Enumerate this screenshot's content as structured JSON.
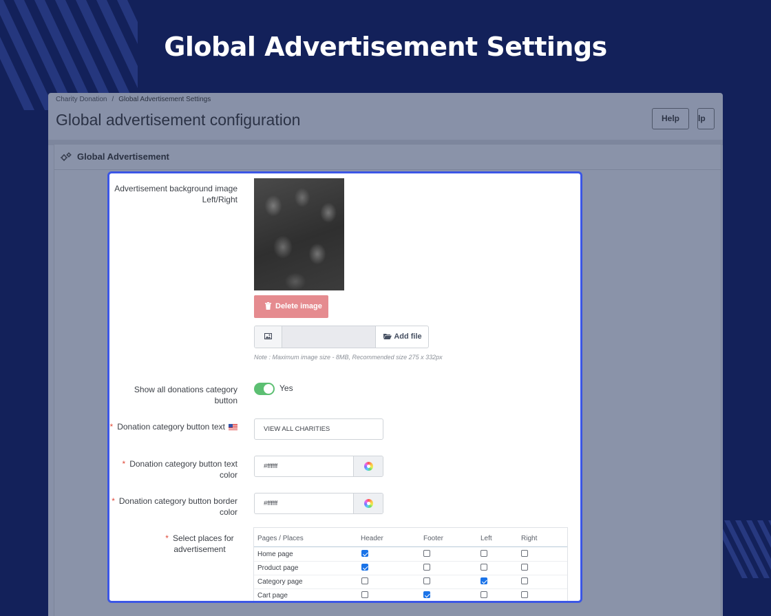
{
  "hero_title": "Global Advertisement Settings",
  "breadcrumb": {
    "parent": "Charity Donation",
    "separator": "/",
    "current": "Global Advertisement Settings"
  },
  "page_title": "Global advertisement configuration",
  "toolbar": {
    "help_label": "Help",
    "help_clipped_label": "lp"
  },
  "card": {
    "title": "Global Advertisement",
    "icon": "gears-icon"
  },
  "form": {
    "bg_image_label": "Advertisement background image Left/Right",
    "delete_image_label": "Delete image",
    "add_file_label": "Add file",
    "file_value": "",
    "note": "Note : Maximum image size - 8MB, Recommended size 275 x 332px",
    "show_all_label": "Show all donations category button",
    "show_all_value": "Yes",
    "show_all_on": true,
    "btn_text_label": "Donation category button text",
    "btn_text_value": "VIEW ALL CHARITIES",
    "text_color_label": "Donation category button text color",
    "text_color_value": "#ffffff",
    "border_color_label": "Donation category button border color",
    "border_color_value": "#ffffff",
    "places_label": "Select places for advertisement",
    "required_mark": "*"
  },
  "places_table": {
    "columns": [
      "Pages / Places",
      "Header",
      "Footer",
      "Left",
      "Right"
    ],
    "rows": [
      {
        "name": "Home page",
        "checks": [
          true,
          false,
          false,
          false
        ]
      },
      {
        "name": "Product page",
        "checks": [
          true,
          false,
          false,
          false
        ]
      },
      {
        "name": "Category page",
        "checks": [
          false,
          false,
          true,
          false
        ]
      },
      {
        "name": "Cart page",
        "checks": [
          false,
          true,
          false,
          false
        ]
      }
    ]
  },
  "colors": {
    "background": "#13215a",
    "focus_border": "#3b56e6",
    "toggle_on": "#5cbf72",
    "delete_button": "#e58b8f",
    "checkbox_on": "#1a73e8"
  }
}
